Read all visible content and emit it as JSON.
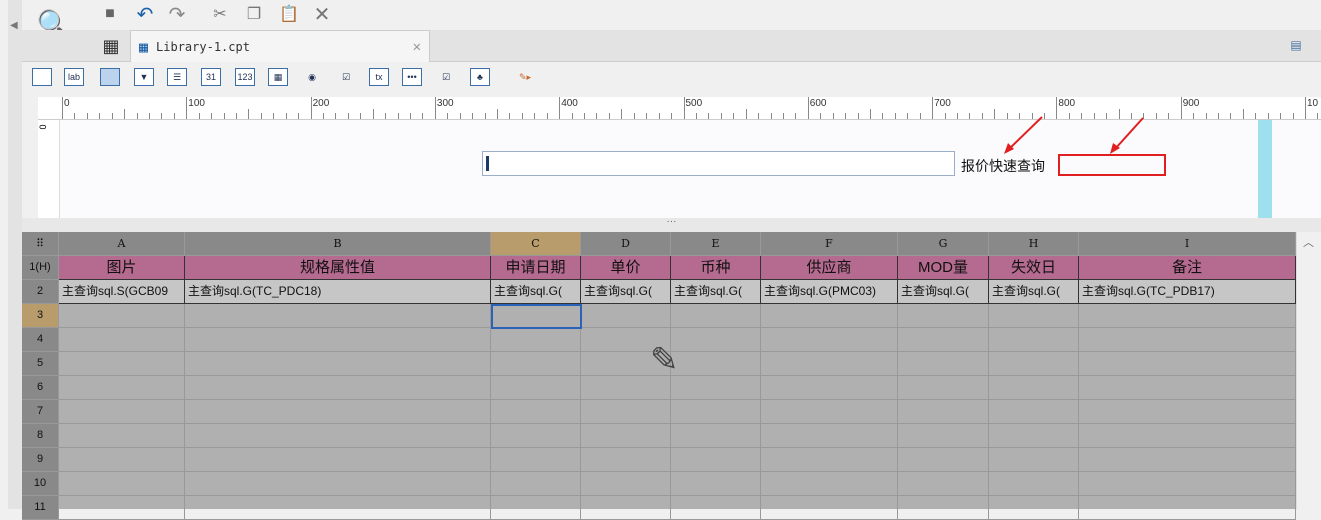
{
  "toolbar": {
    "icons": [
      "template-search-icon",
      "save-icon",
      "undo-icon",
      "redo-icon",
      "cut-icon",
      "copy-icon",
      "paste-icon",
      "delete-icon"
    ]
  },
  "tab": {
    "title": "Library-1.cpt"
  },
  "widgets": [
    "text-widget",
    "label-widget",
    "button-widget",
    "combo-widget",
    "list-widget",
    "date-widget",
    "number-widget",
    "table-widget",
    "radio-widget",
    "checkbox-widget",
    "textarea-widget",
    "password-widget",
    "checkbox-group-widget",
    "tree-widget",
    "more-widget"
  ],
  "widget_labels": {
    "label": "lab",
    "date": "31",
    "number": "123",
    "textarea": "tx",
    "password": "•••"
  },
  "ruler": {
    "labels": [
      "0",
      "100",
      "200",
      "300",
      "400",
      "500",
      "600",
      "700",
      "800",
      "900",
      "10"
    ],
    "v_label": "0"
  },
  "form": {
    "query_label": "报价快速查询"
  },
  "grid": {
    "columns": [
      "A",
      "B",
      "C",
      "D",
      "E",
      "F",
      "G",
      "H",
      "I"
    ],
    "rows": [
      "1(H)",
      "2",
      "3",
      "4",
      "5",
      "6",
      "7",
      "8",
      "9",
      "10",
      "11"
    ],
    "headers": [
      "图片",
      "规格属性值",
      "申请日期",
      "单价",
      "币种",
      "供应商",
      "MOD量",
      "失效日",
      "备注"
    ],
    "data": [
      "主查询sql.S(GCB09",
      "主查询sql.G(TC_PDC18)",
      "主查询sql.G(",
      "主查询sql.G(",
      "主查询sql.G(",
      "主查询sql.G(PMC03)",
      "主查询sql.G(",
      "主查询sql.G(",
      "主查询sql.G(TC_PDB17)"
    ]
  },
  "colors": {
    "header": "#b56a8f",
    "selected": "#b89c6b",
    "selection": "#2a62b8"
  }
}
